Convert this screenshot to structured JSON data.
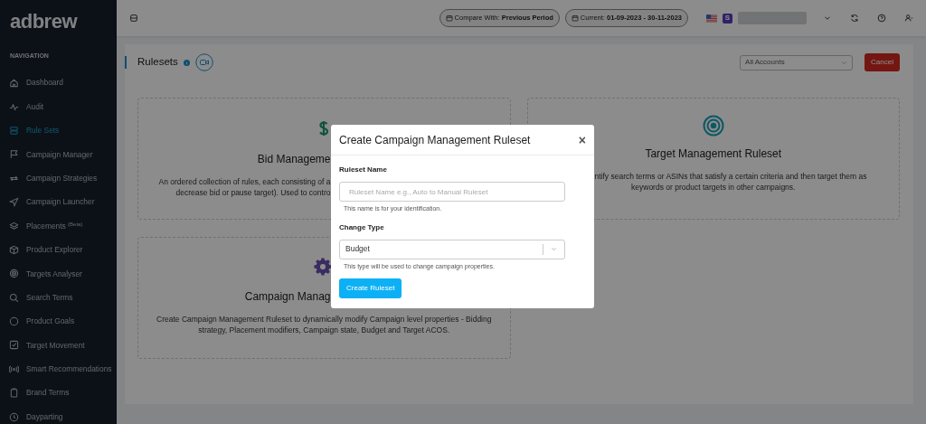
{
  "sidebar": {
    "logo": "adbrew",
    "section": "NAVIGATION",
    "items": [
      {
        "label": "Dashboard",
        "selected": false
      },
      {
        "label": "Audit",
        "selected": false
      },
      {
        "label": "Rule Sets",
        "selected": true
      },
      {
        "label": "Campaign Manager",
        "selected": false
      },
      {
        "label": "Campaign Strategies",
        "selected": false
      },
      {
        "label": "Campaign Launcher",
        "selected": false
      },
      {
        "label": "Placements $^{(Beta)}$",
        "selected": false
      },
      {
        "label": "Product Explorer",
        "selected": false
      },
      {
        "label": "Targets Analyser",
        "selected": false
      },
      {
        "label": "Search Terms",
        "selected": false
      },
      {
        "label": "Product Goals",
        "selected": false
      },
      {
        "label": "Target Movement",
        "selected": false
      },
      {
        "label": "Smart Recommendations",
        "selected": false
      },
      {
        "label": "Brand Terms",
        "selected": false
      },
      {
        "label": "Dayparting",
        "selected": false
      }
    ]
  },
  "topbar": {
    "compare": "Compare With: **Previous Period**",
    "current": "Current: **01-09-2023 - 30-11-2023**",
    "badge": "S"
  },
  "header": {
    "title": "Rulesets",
    "account_select": "All Accounts",
    "cancel": "Cancel"
  },
  "cards": [
    {
      "kind": "bid",
      "title": "Bid Manageme",
      "lines": [
        "An ordered collection of rules, each consisting of a",
        "decrease bid or pause target). Used to contro"
      ]
    },
    {
      "kind": "target",
      "title": "Target Management Ruleset",
      "lines": [
        "ntify search terms or ASINs that satisfy a certain criteria and then target them as",
        "keywords or product targets in other campaigns."
      ]
    },
    {
      "kind": "campaign",
      "title": "Campaign Manag",
      "lines": [
        "Create Campaign Management Ruleset to dynamically modify Campaign level properties - Bidding strategy, Placement modifiers, Campaign state, Budget and Target ACOS."
      ]
    }
  ],
  "modal": {
    "title": "Create Campaign Management Ruleset",
    "close": "×",
    "name_label": "Ruleset Name",
    "name_placeholder": "Ruleset Name e.g., Auto to Manual Ruleset",
    "name_help": "This name is for your identification.",
    "type_label": "Change Type",
    "type_value": "Budget",
    "type_help": "This type will be used to change campaign properties.",
    "submit": "Create Ruleset"
  }
}
